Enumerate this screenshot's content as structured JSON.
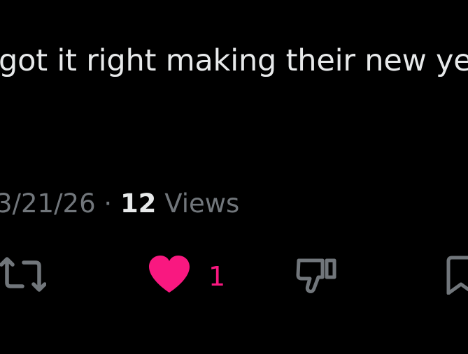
{
  "tweet": {
    "text": "got it right making their new ye"
  },
  "meta": {
    "date": "3/21/26",
    "separator": "·",
    "views_count": "12",
    "views_label": "Views"
  },
  "actions": {
    "retweet_icon": "retweet-icon",
    "like_icon": "heart-icon",
    "like_count": "1",
    "like_active": true,
    "dislike_icon": "thumbs-down-icon",
    "bookmark_icon": "bookmark-icon"
  },
  "colors": {
    "background": "#000000",
    "text_primary": "#e7e9ea",
    "text_secondary": "#71767b",
    "like_accent": "#f91880"
  }
}
